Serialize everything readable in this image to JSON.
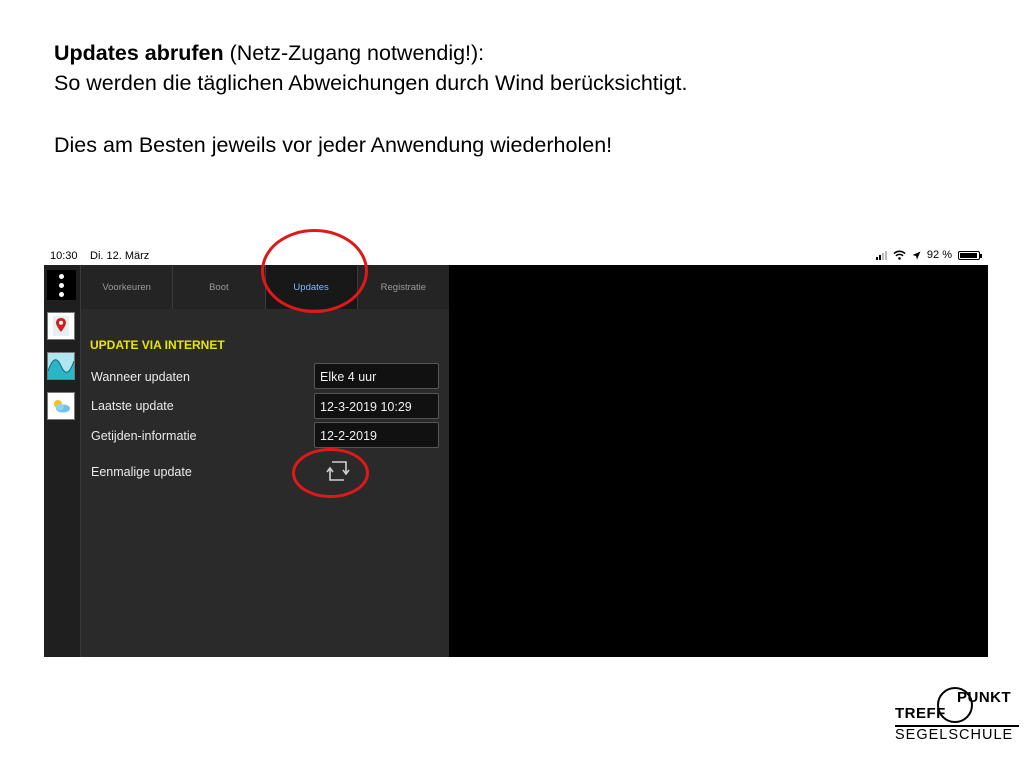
{
  "slide": {
    "line1_bold": "Updates  abrufen",
    "line1_rest": " (Netz-Zugang notwendig!):",
    "line2": "So werden die täglichen Abweichungen durch Wind berücksichtigt.",
    "line3": "Dies am Besten jeweils vor jeder Anwendung wiederholen!"
  },
  "status_bar": {
    "time": "10:30",
    "date": "Di. 12. März",
    "battery": "92 %",
    "battery_level": 0.92
  },
  "tabs": [
    {
      "label": "Voorkeuren",
      "active": false
    },
    {
      "label": "Boot",
      "active": false
    },
    {
      "label": "Updates",
      "active": true
    },
    {
      "label": "Registratie",
      "active": false
    }
  ],
  "section": {
    "title": "UPDATE VIA INTERNET",
    "rows": [
      {
        "label": "Wanneer updaten",
        "value": "Elke 4 uur"
      },
      {
        "label": "Laatste update",
        "value": "12-3-2019 10:29"
      },
      {
        "label": "Getijden-informatie",
        "value": "12-2-2019"
      }
    ],
    "single_update_label": "Eenmalige update"
  },
  "rail_icons": [
    "map-pin-icon",
    "tide-wave-icon",
    "weather-icon"
  ],
  "colors": {
    "section_title": "#e8e600",
    "active_tab_text": "#7fb8ff",
    "highlight": "#e01818"
  },
  "logo": {
    "treff": "TREFF",
    "punkt": "PUNKT",
    "segelschule": "SEGELSCHULE"
  }
}
